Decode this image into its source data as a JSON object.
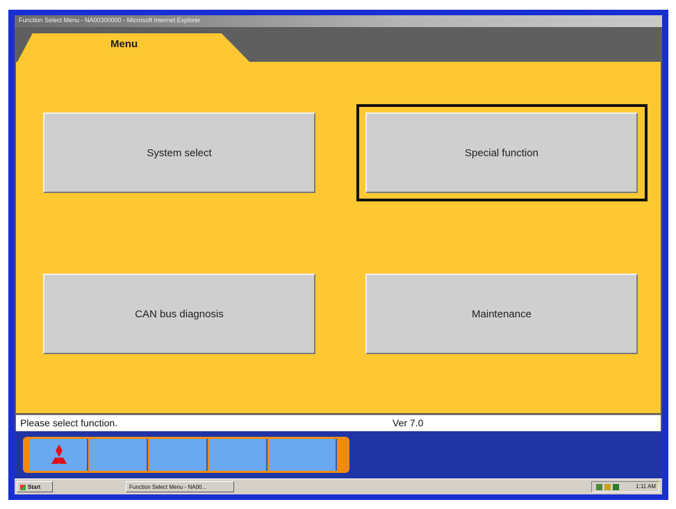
{
  "window": {
    "title": "Function Select Menu - NA00300000 - Microsoft Internet Explorer"
  },
  "tab": {
    "label": "Menu"
  },
  "buttons": {
    "system_select": "System select",
    "special_function": "Special function",
    "can_bus_diagnosis": "CAN bus diagnosis",
    "maintenance": "Maintenance"
  },
  "status": {
    "message": "Please select function.",
    "version": "Ver 7.0"
  },
  "toolbar": {
    "logo_icon": "mitsubishi-logo-icon",
    "cell_count_visible": 5
  },
  "taskbar": {
    "start_label": "Start",
    "task_label": "Function Select Menu - NA00...",
    "time": "1:11 AM"
  },
  "colors": {
    "panel": "#fec832",
    "frame": "#1a2fd0",
    "toolbar": "#1f35a6",
    "tool_group": "#f08a10",
    "tool_cell": "#6aa8f0",
    "logo": "#e0101c"
  }
}
